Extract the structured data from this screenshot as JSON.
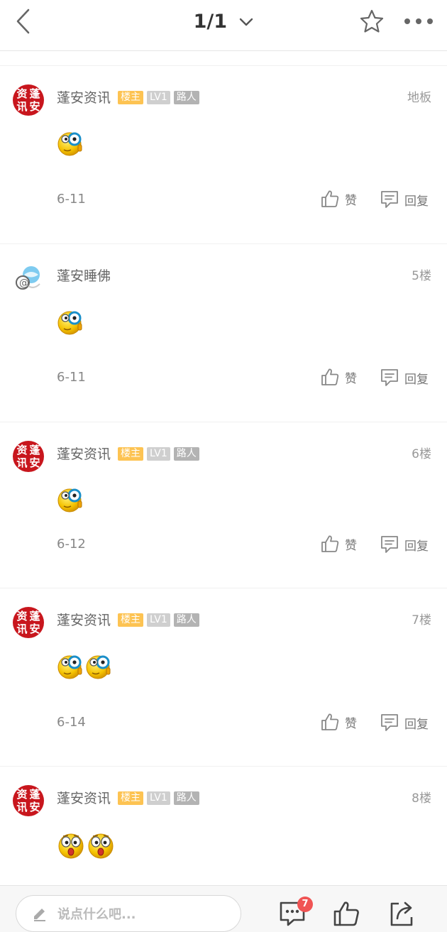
{
  "header": {
    "page_indicator": "1/1",
    "icons": {
      "back": "chevron-left-icon",
      "dropdown": "chevron-down-icon",
      "favorite": "star-icon",
      "more": "more-dots-icon"
    }
  },
  "posts": [
    {
      "username": "蓬安资讯",
      "avatar": "red-seal-avatar",
      "avatar_text": [
        "资",
        "蓬",
        "讯",
        "安"
      ],
      "badges": [
        "楼主",
        "LV1",
        "路人"
      ],
      "floor": "地板",
      "emoji_count": 1,
      "emoji_style": "peek",
      "date": "6-11",
      "like_label": "赞",
      "reply_label": "回复"
    },
    {
      "username": "蓬安睡佛",
      "avatar": "globe-avatar",
      "badges": [],
      "floor": "5楼",
      "emoji_count": 1,
      "emoji_style": "peek",
      "date": "6-11",
      "like_label": "赞",
      "reply_label": "回复"
    },
    {
      "username": "蓬安资讯",
      "avatar": "red-seal-avatar",
      "avatar_text": [
        "资",
        "蓬",
        "讯",
        "安"
      ],
      "badges": [
        "楼主",
        "LV1",
        "路人"
      ],
      "floor": "6楼",
      "emoji_count": 1,
      "emoji_style": "peek",
      "date": "6-12",
      "like_label": "赞",
      "reply_label": "回复"
    },
    {
      "username": "蓬安资讯",
      "avatar": "red-seal-avatar",
      "avatar_text": [
        "资",
        "蓬",
        "讯",
        "安"
      ],
      "badges": [
        "楼主",
        "LV1",
        "路人"
      ],
      "floor": "7楼",
      "emoji_count": 2,
      "emoji_style": "peek",
      "date": "6-14",
      "like_label": "赞",
      "reply_label": "回复"
    },
    {
      "username": "蓬安资讯",
      "avatar": "red-seal-avatar",
      "avatar_text": [
        "资",
        "蓬",
        "讯",
        "安"
      ],
      "badges": [
        "楼主",
        "LV1",
        "路人"
      ],
      "floor": "8楼",
      "emoji_count": 2,
      "emoji_style": "shocked",
      "date": "",
      "like_label": "",
      "reply_label": ""
    }
  ],
  "bottom_bar": {
    "comment_placeholder": "说点什么吧...",
    "comment_count_badge": "7",
    "icons": {
      "edit": "pencil-icon",
      "comments": "comment-icon",
      "like": "thumbs-up-icon",
      "share": "share-icon"
    }
  },
  "colors": {
    "owner_badge": "#fdc352",
    "level_badge": "#cfcfcf",
    "role_badge": "#b3b3b3",
    "notification": "#f05454",
    "avatar_red": "#c8161d"
  }
}
